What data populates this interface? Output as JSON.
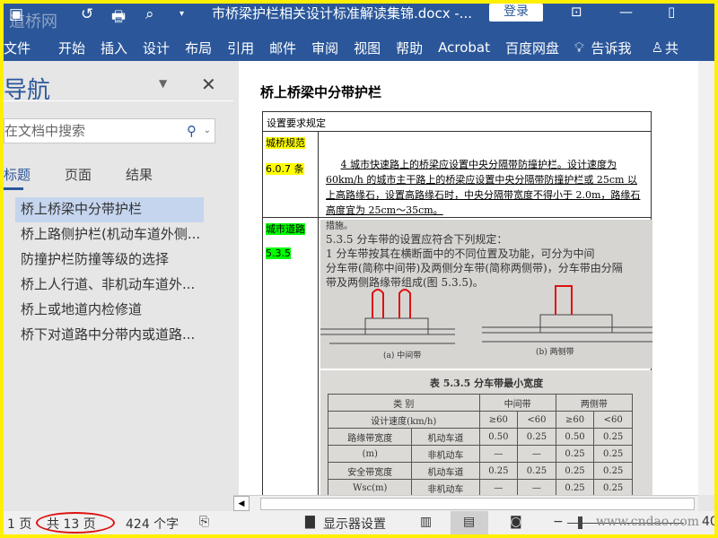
{
  "titlebar": {
    "logo_text": "道桥网",
    "doc_title": "市桥梁护栏相关设计标准解读集锦.docx  -...",
    "login_label": "登录",
    "icons": [
      "save-icon",
      "undo-icon",
      "print-icon",
      "print-preview-icon",
      "customize-icon",
      "ribbon-display-icon",
      "minimize-icon",
      "maximize-icon"
    ]
  },
  "ribbon": {
    "tabs": [
      "文件",
      "开始",
      "插入",
      "设计",
      "布局",
      "引用",
      "邮件",
      "审阅",
      "视图",
      "帮助",
      "Acrobat",
      "百度网盘"
    ],
    "tell_me": "告诉我",
    "share": "共"
  },
  "nav": {
    "title": "导航",
    "search_placeholder": "在文档中搜索",
    "tabs": [
      "标题",
      "页面",
      "结果"
    ],
    "headings": [
      "桥上桥梁中分带护栏",
      "桥上路侧护栏(机动车道外侧...",
      "防撞护栏防撞等级的选择",
      "桥上人行道、非机动车道外...",
      "桥上或地道内检修道",
      "桥下对道路中分带内或道路..."
    ]
  },
  "document": {
    "heading": "桥上桥梁中分带护栏",
    "row1": "设置要求规定",
    "ref1_line1": "城桥规范",
    "ref1_line2": "6.0.7 条",
    "clause": "4  城市快速路上的桥梁应设置中央分隔带防撞护栏。设计速度为 60km/h 的城市主干路上的桥梁应设置中央分隔带防撞护栏或 25cm 以上高路缘石，设置高路缘石时，中央分隔带宽度不得小于 2.0m，路缘石高度宜为 25cm～35cm。",
    "ref2_line1": "城市道路",
    "ref2_line2": "5.3.5",
    "scan1": {
      "line0": "措施。",
      "line1": "5.3.5  分车带的设置应符合下列规定：",
      "line2": "1  分车带按其在横断面中的不同位置及功能，可分为中间",
      "line3": "分车带(简称中间带)及两侧分车带(简称两侧带)，分车带由分隔",
      "line4": "带及两侧路缘带组成(图 5.3.5)。",
      "fig_a": "(a) 中间带",
      "fig_b": "(b) 两侧带"
    },
    "scan2": {
      "caption": "表 5.3.5  分车带最小宽度",
      "header": [
        "类    别",
        "中间带",
        "两侧带"
      ],
      "speed_row": [
        "设计速度(km/h)",
        "≥60",
        "<60",
        "≥60",
        "<60"
      ],
      "rows": [
        [
          "路缘带宽度",
          "机动车道",
          "0.50",
          "0.25",
          "0.50",
          "0.25"
        ],
        [
          "(m)",
          "非机动车",
          "—",
          "—",
          "0.25",
          "0.25"
        ],
        [
          "安全带宽度",
          "机动车道",
          "0.25",
          "0.25",
          "0.25",
          "0.25"
        ],
        [
          "Wsc(m)",
          "非机动车",
          "—",
          "—",
          "0.25",
          "0.25"
        ]
      ]
    }
  },
  "status": {
    "page": "1 页",
    "total": "共 13 页",
    "words": "424 个字",
    "display_settings": "显示器设置",
    "zoom_minus": "−",
    "watermark": "www.cndao.com",
    "zoom_value": "40"
  },
  "colors": {
    "brand": "#2b579a",
    "border": "#ffef00",
    "highlight_yellow": "#ffff00",
    "highlight_green": "#00ff00",
    "annotation": "#d11111"
  }
}
